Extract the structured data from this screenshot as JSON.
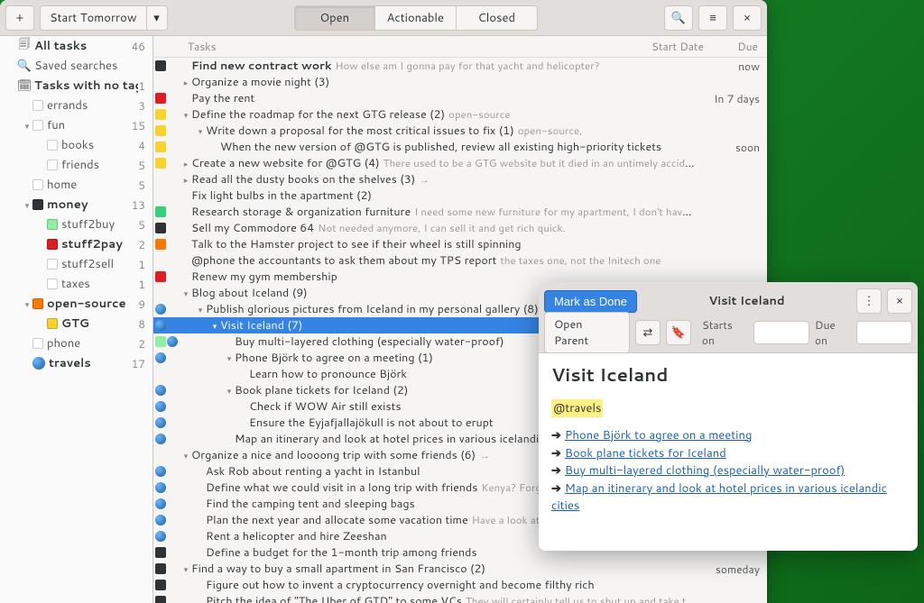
{
  "toolbar": {
    "add": "+",
    "start": "Start Tomorrow",
    "views": {
      "open": "Open",
      "actionable": "Actionable",
      "closed": "Closed"
    }
  },
  "sidebar": [
    {
      "label": "All tasks",
      "count": "46",
      "ico": "copy",
      "bold": true
    },
    {
      "label": "Saved searches",
      "ico": "search"
    },
    {
      "label": "Tasks with no tags",
      "count": "1",
      "ico": "calendar",
      "bold": true
    },
    {
      "label": "errands",
      "count": "3",
      "indent": 1,
      "sw": "none"
    },
    {
      "label": "fun",
      "count": "15",
      "indent": 1,
      "sw": "none",
      "chev": "down"
    },
    {
      "label": "books",
      "count": "4",
      "indent": 2,
      "sw": "none"
    },
    {
      "label": "friends",
      "count": "5",
      "indent": 2,
      "sw": "none"
    },
    {
      "label": "home",
      "count": "5",
      "indent": 1,
      "sw": "none"
    },
    {
      "label": "money",
      "count": "13",
      "indent": 1,
      "sw": "black",
      "bold": true,
      "chev": "down"
    },
    {
      "label": "stuff2buy",
      "count": "5",
      "indent": 2,
      "sw": "lime"
    },
    {
      "label": "stuff2pay",
      "count": "2",
      "indent": 2,
      "sw": "red",
      "bold": true
    },
    {
      "label": "stuff2sell",
      "count": "1",
      "indent": 2,
      "sw": "none"
    },
    {
      "label": "taxes",
      "count": "1",
      "indent": 2,
      "sw": "none"
    },
    {
      "label": "open-source",
      "count": "9",
      "indent": 1,
      "sw": "orange",
      "bold": true,
      "chev": "down"
    },
    {
      "label": "GTG",
      "count": "8",
      "indent": 2,
      "sw": "yellow",
      "bold": true
    },
    {
      "label": "phone",
      "count": "2",
      "indent": 1,
      "sw": "none"
    },
    {
      "label": "travels",
      "count": "17",
      "indent": 1,
      "globe": true,
      "bold": true
    }
  ],
  "columns": {
    "tasks": "Tasks",
    "start": "Start Date",
    "due": "Due"
  },
  "tasks": [
    {
      "marks": [
        "black"
      ],
      "indent": 0,
      "chev": "",
      "bold": true,
      "title": "Find new contract work",
      "sub": "How else am I gonna pay for that yacht and helicopter?",
      "due": "now"
    },
    {
      "marks": [],
      "indent": 0,
      "chev": "right",
      "title": "Organize a movie night (3)"
    },
    {
      "marks": [
        "red"
      ],
      "indent": 0,
      "chev": "",
      "title": "Pay the rent",
      "due": "In 7 days"
    },
    {
      "marks": [
        "yellow"
      ],
      "indent": 0,
      "chev": "down",
      "title": "Define the roadmap for the next GTG release (2)",
      "sub": "open-source"
    },
    {
      "marks": [
        "yellow"
      ],
      "indent": 1,
      "chev": "down",
      "title": "Write down a proposal for the most critical issues to fix (1)",
      "sub": "open-source,"
    },
    {
      "marks": [
        "yellow"
      ],
      "indent": 2,
      "chev": "",
      "title": "When the new version of @GTG is published, review all existing high-priority tickets",
      "due": "soon"
    },
    {
      "marks": [
        "yellow"
      ],
      "indent": 0,
      "chev": "right",
      "title": "Create a new website for @GTG (4)",
      "sub": "There used to be a GTG website but it died in an untimely accident. We could consid…"
    },
    {
      "marks": [],
      "indent": 0,
      "chev": "right",
      "title": "Read all the dusty books on the shelves (3)",
      "sub": "→"
    },
    {
      "marks": [],
      "indent": 0,
      "chev": "",
      "title": "Fix light bulbs in the apartment (2)"
    },
    {
      "marks": [
        "green"
      ],
      "indent": 0,
      "chev": "",
      "title": "Research storage & organization furniture",
      "sub": "I need some new furniture for my apartment, I don't have enough space to …"
    },
    {
      "marks": [
        "black"
      ],
      "indent": 0,
      "chev": "",
      "title": "Sell my Commodore 64",
      "sub": "Not needed anymore, I can sell it and get rich quick."
    },
    {
      "marks": [
        "orange"
      ],
      "indent": 0,
      "chev": "",
      "title": "Talk to the Hamster project to see if their wheel is still spinning"
    },
    {
      "marks": [],
      "indent": 0,
      "chev": "",
      "title": "@phone the accountants to ask them about my TPS report",
      "sub": "the taxes one, not the Initech one"
    },
    {
      "marks": [
        "red"
      ],
      "indent": 0,
      "chev": "",
      "title": "Renew my gym membership"
    },
    {
      "marks": [],
      "indent": 0,
      "chev": "down",
      "title": "Blog about Iceland (9)"
    },
    {
      "marks": [
        "globe"
      ],
      "indent": 1,
      "chev": "down",
      "title": "Publish glorious pictures from Iceland in my personal gallery (8)"
    },
    {
      "marks": [
        "globe"
      ],
      "indent": 2,
      "chev": "down",
      "title": "Visit Iceland (7)",
      "selected": true
    },
    {
      "marks": [
        "lime",
        "globe"
      ],
      "indent": 3,
      "chev": "",
      "title": "Buy multi-layered clothing (especially water-proof)"
    },
    {
      "marks": [
        "globe"
      ],
      "indent": 3,
      "chev": "down",
      "title": "Phone Björk to agree on a meeting (1)"
    },
    {
      "marks": [],
      "indent": 4,
      "chev": "",
      "title": "Learn how to pronounce Björk"
    },
    {
      "marks": [
        "globe"
      ],
      "indent": 3,
      "chev": "down",
      "title": "Book plane tickets for Iceland (2)"
    },
    {
      "marks": [
        "globe"
      ],
      "indent": 4,
      "chev": "",
      "title": "Check if WOW Air still exists"
    },
    {
      "marks": [
        "globe"
      ],
      "indent": 4,
      "chev": "",
      "title": "Ensure the Eyjafjallajökull is not about to erupt"
    },
    {
      "marks": [
        "globe"
      ],
      "indent": 3,
      "chev": "",
      "title": "Map an itinerary and look at hotel prices in various icelandic cities"
    },
    {
      "marks": [],
      "indent": 0,
      "chev": "down",
      "title": "Organize a nice and loooong trip with some friends (6)",
      "sub": "→"
    },
    {
      "marks": [
        "globe"
      ],
      "indent": 1,
      "chev": "",
      "title": "Ask Rob about renting a yacht in Istanbul"
    },
    {
      "marks": [
        "globe"
      ],
      "indent": 1,
      "chev": "",
      "title": "Define what we could visit in a long trip with friends",
      "sub": "Kenya? Forget about Norway!"
    },
    {
      "marks": [
        "globe"
      ],
      "indent": 1,
      "chev": "",
      "title": "Find the camping tent and sleeping bags"
    },
    {
      "marks": [
        "globe"
      ],
      "indent": 1,
      "chev": "",
      "title": "Plan the next year and allocate some vacation time",
      "sub": "Have a look at the calendar, to"
    },
    {
      "marks": [
        "globe"
      ],
      "indent": 1,
      "chev": "",
      "title": "Rent a helicopter and hire Zeeshan"
    },
    {
      "marks": [
        "black"
      ],
      "indent": 1,
      "chev": "",
      "title": "Define a budget for the 1-month trip among friends"
    },
    {
      "marks": [
        "black"
      ],
      "indent": 0,
      "chev": "down",
      "title": "Find a way to buy a small apartment in San Francisco (2)",
      "due": "someday"
    },
    {
      "marks": [
        "black"
      ],
      "indent": 1,
      "chev": "",
      "title": "Figure out how to invent a cryptocurrency overnight and become filthy rich"
    },
    {
      "marks": [
        "black"
      ],
      "indent": 1,
      "chev": "",
      "title": "Pitch the idea of \"The Uber of GTD\" to some VCs",
      "sub": "They will certainly tell us to shut up and take their money"
    }
  ],
  "editor": {
    "window_title": "Visit Iceland",
    "done": "Mark as Done",
    "open_parent": "Open Parent",
    "starts": "Starts on",
    "due": "Due on",
    "heading": "Visit Iceland",
    "tag": "@travels",
    "links": [
      "Phone Björk to agree on a meeting",
      "Book plane tickets for Iceland",
      "Buy multi-layered clothing (especially water-proof)",
      "Map an itinerary and look at hotel prices in various icelandic cities"
    ]
  }
}
